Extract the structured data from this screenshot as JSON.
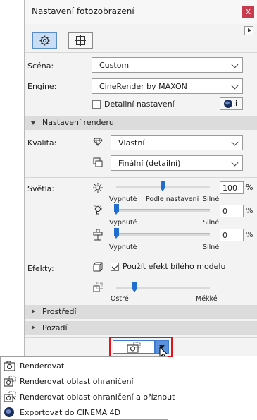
{
  "window": {
    "title": "Nastavení fotozobrazení",
    "close_label": "x"
  },
  "tabs": [
    {
      "name": "settings",
      "icon": "gear-icon",
      "active": true
    },
    {
      "name": "size",
      "icon": "frame-size-icon",
      "active": false
    }
  ],
  "scene": {
    "label": "Scéna:",
    "value": "Custom"
  },
  "engine": {
    "label": "Engine:",
    "value": "CineRender by MAXON"
  },
  "detail": {
    "label": "Detailní nastavení",
    "checked": false,
    "info_label": "i"
  },
  "render_section": {
    "title": "Nastavení renderu"
  },
  "quality": {
    "label": "Kvalita:",
    "quality_value": "Vlastní",
    "output_value": "Finální (detailní)"
  },
  "lights": {
    "label": "Světla:",
    "sliders": [
      {
        "icon": "sun-icon",
        "value": "100",
        "unit": "%",
        "min_label": "Vypnuté",
        "mid_label": "Podle nastavení",
        "max_label": "Silné",
        "level": 0.5
      },
      {
        "icon": "bulb-icon",
        "value": "0",
        "unit": "%",
        "min_label": "Vypnuté",
        "max_label": "Silné",
        "level": 0.0
      },
      {
        "icon": "light-fixture-icon",
        "value": "0",
        "unit": "%",
        "min_label": "Vypnuté",
        "max_label": "Silné",
        "level": 0.0
      }
    ]
  },
  "effects": {
    "label": "Efekty:",
    "white_model_label": "Použít efekt bílého modelu",
    "white_model_checked": true,
    "softness": {
      "min_label": "Ostré",
      "max_label": "Měkké",
      "level": 0.2
    }
  },
  "collapsed_sections": [
    {
      "title": "Prostředí"
    },
    {
      "title": "Pozadí"
    }
  ],
  "render_button": {
    "icon": "camera-icon",
    "dropdown_icon": "chevron-down-icon"
  },
  "menu": {
    "items": [
      {
        "label": "Renderovat",
        "icon": "camera-icon"
      },
      {
        "label": "Renderovat oblast ohraničení",
        "icon": "camera-marquee-icon"
      },
      {
        "label": "Renderovat oblast ohraničení a oříznout",
        "icon": "camera-crop-icon"
      },
      {
        "label": "Exportovat do CINEMA 4D",
        "icon": "cinema4d-icon"
      }
    ]
  },
  "colors": {
    "accent": "#1f6ed0",
    "highlight_border": "#e0161e",
    "close": "#c83a4d",
    "section": "#dcdcdc"
  }
}
